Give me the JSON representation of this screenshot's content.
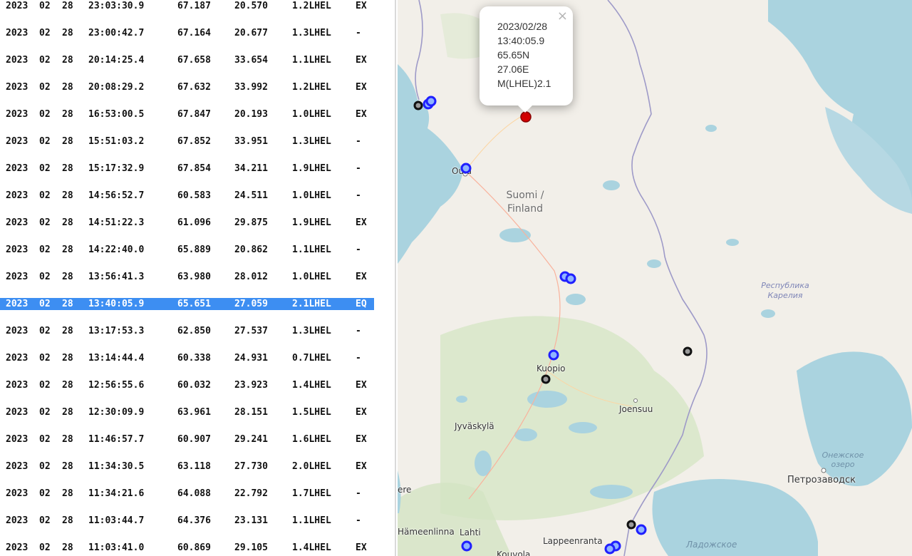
{
  "event_list": {
    "rows": [
      {
        "year": "2023",
        "month": "02",
        "day": "28",
        "time": "23:03:30.9",
        "lat": "67.187",
        "lon": "20.570",
        "mag": "1.2LHEL",
        "type": "EX"
      },
      {
        "year": "2023",
        "month": "02",
        "day": "28",
        "time": "23:00:42.7",
        "lat": "67.164",
        "lon": "20.677",
        "mag": "1.3LHEL",
        "type": "-"
      },
      {
        "year": "2023",
        "month": "02",
        "day": "28",
        "time": "20:14:25.4",
        "lat": "67.658",
        "lon": "33.654",
        "mag": "1.1LHEL",
        "type": "EX"
      },
      {
        "year": "2023",
        "month": "02",
        "day": "28",
        "time": "20:08:29.2",
        "lat": "67.632",
        "lon": "33.992",
        "mag": "1.2LHEL",
        "type": "EX"
      },
      {
        "year": "2023",
        "month": "02",
        "day": "28",
        "time": "16:53:00.5",
        "lat": "67.847",
        "lon": "20.193",
        "mag": "1.0LHEL",
        "type": "EX"
      },
      {
        "year": "2023",
        "month": "02",
        "day": "28",
        "time": "15:51:03.2",
        "lat": "67.852",
        "lon": "33.951",
        "mag": "1.3LHEL",
        "type": "-"
      },
      {
        "year": "2023",
        "month": "02",
        "day": "28",
        "time": "15:17:32.9",
        "lat": "67.854",
        "lon": "34.211",
        "mag": "1.9LHEL",
        "type": "-"
      },
      {
        "year": "2023",
        "month": "02",
        "day": "28",
        "time": "14:56:52.7",
        "lat": "60.583",
        "lon": "24.511",
        "mag": "1.0LHEL",
        "type": "-"
      },
      {
        "year": "2023",
        "month": "02",
        "day": "28",
        "time": "14:51:22.3",
        "lat": "61.096",
        "lon": "29.875",
        "mag": "1.9LHEL",
        "type": "EX"
      },
      {
        "year": "2023",
        "month": "02",
        "day": "28",
        "time": "14:22:40.0",
        "lat": "65.889",
        "lon": "20.862",
        "mag": "1.1LHEL",
        "type": "-"
      },
      {
        "year": "2023",
        "month": "02",
        "day": "28",
        "time": "13:56:41.3",
        "lat": "63.980",
        "lon": "28.012",
        "mag": "1.0LHEL",
        "type": "EX"
      },
      {
        "year": "2023",
        "month": "02",
        "day": "28",
        "time": "13:40:05.9",
        "lat": "65.651",
        "lon": "27.059",
        "mag": "2.1LHEL",
        "type": "EQ",
        "selected": true
      },
      {
        "year": "2023",
        "month": "02",
        "day": "28",
        "time": "13:17:53.3",
        "lat": "62.850",
        "lon": "27.537",
        "mag": "1.3LHEL",
        "type": "-"
      },
      {
        "year": "2023",
        "month": "02",
        "day": "28",
        "time": "13:14:44.4",
        "lat": "60.338",
        "lon": "24.931",
        "mag": "0.7LHEL",
        "type": "-"
      },
      {
        "year": "2023",
        "month": "02",
        "day": "28",
        "time": "12:56:55.6",
        "lat": "60.032",
        "lon": "23.923",
        "mag": "1.4LHEL",
        "type": "EX"
      },
      {
        "year": "2023",
        "month": "02",
        "day": "28",
        "time": "12:30:09.9",
        "lat": "63.961",
        "lon": "28.151",
        "mag": "1.5LHEL",
        "type": "EX"
      },
      {
        "year": "2023",
        "month": "02",
        "day": "28",
        "time": "11:46:57.7",
        "lat": "60.907",
        "lon": "29.241",
        "mag": "1.6LHEL",
        "type": "EX"
      },
      {
        "year": "2023",
        "month": "02",
        "day": "28",
        "time": "11:34:30.5",
        "lat": "63.118",
        "lon": "27.730",
        "mag": "2.0LHEL",
        "type": "EX"
      },
      {
        "year": "2023",
        "month": "02",
        "day": "28",
        "time": "11:34:21.6",
        "lat": "64.088",
        "lon": "22.792",
        "mag": "1.7LHEL",
        "type": "-"
      },
      {
        "year": "2023",
        "month": "02",
        "day": "28",
        "time": "11:03:44.7",
        "lat": "64.376",
        "lon": "23.131",
        "mag": "1.1LHEL",
        "type": "-"
      },
      {
        "year": "2023",
        "month": "02",
        "day": "28",
        "time": "11:03:41.0",
        "lat": "60.869",
        "lon": "29.105",
        "mag": "1.4LHEL",
        "type": "EX"
      }
    ]
  },
  "map": {
    "labels": {
      "country_line1": "Suomi /",
      "country_line2": "Finland",
      "region_line1": "Республика",
      "region_line2": "Карелия",
      "lake_onega_line1": "Онежское",
      "lake_onega_line2": "озеро",
      "lake_ladoga": "Ладожское",
      "oulu": "Oulu",
      "kuopio": "Kuopio",
      "joensuu": "Joensuu",
      "jyvaskyla": "Jyväskylä",
      "petrozavodsk": "Петрозаводск",
      "hameenlinna": "Hämeenlinna",
      "lahti": "Lahti",
      "lappeenranta": "Lappeenranta",
      "kouvola": "Kouvola",
      "pori": "ere"
    },
    "markers": {
      "selected_color": "#d40000",
      "explosion_color": "#1f1fff",
      "other_color": "#111111"
    }
  },
  "popup": {
    "date": "2023/02/28",
    "time": "13:40:05.9",
    "lat": "65.65N",
    "lon": "27.06E",
    "magnitude": "M(LHEL)2.1",
    "close_symbol": "×"
  }
}
